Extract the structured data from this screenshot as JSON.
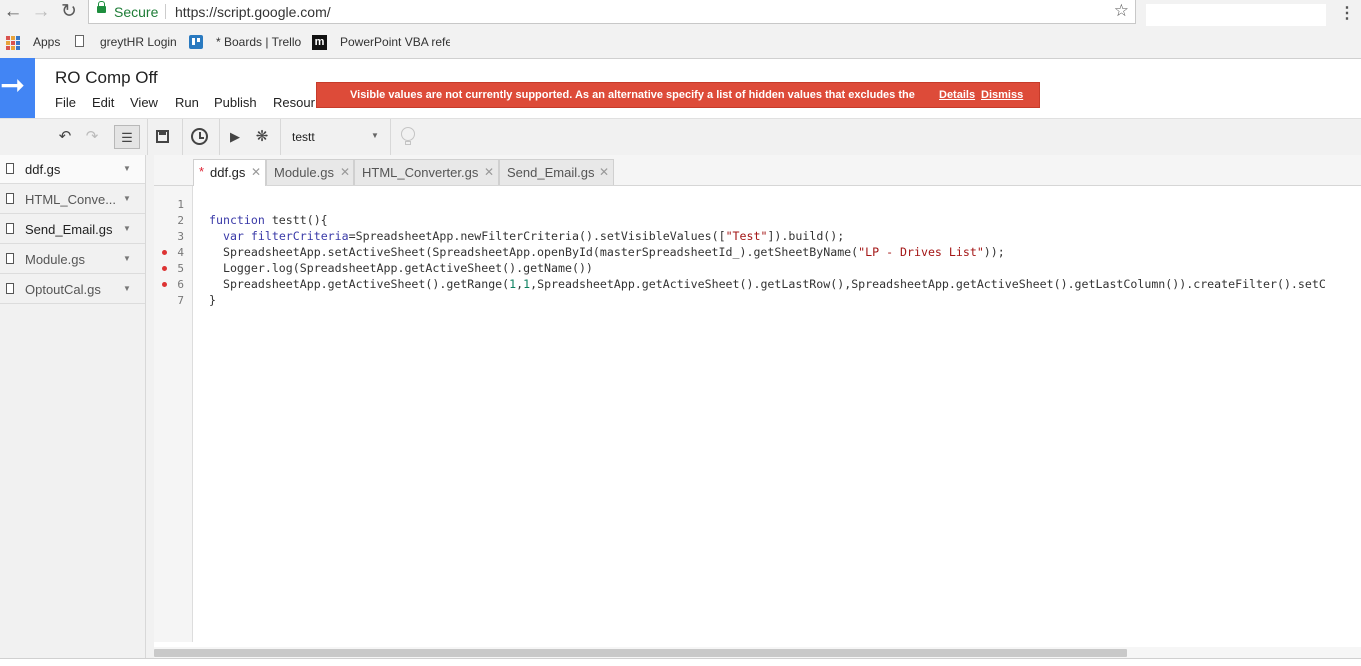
{
  "browser": {
    "secure_label": "Secure",
    "url": "https://script.google.com/",
    "bookmarks": [
      "Apps",
      "greytHR Login",
      "* Boards | Trello",
      "PowerPoint VBA refe"
    ]
  },
  "app": {
    "project_title": "RO Comp Off",
    "menu": [
      "File",
      "Edit",
      "View",
      "Run",
      "Publish",
      "Resour"
    ]
  },
  "banner": {
    "message": "Visible values are not currently supported. As an alternative specify a list of hidden values that excludes the",
    "details_label": "Details",
    "dismiss_label": "Dismiss",
    "color": "#dd4b39"
  },
  "toolbar": {
    "function_select": "testt"
  },
  "files": [
    {
      "name": "ddf.gs",
      "active": true
    },
    {
      "name": "HTML_Conve...",
      "active": false
    },
    {
      "name": "Send_Email.gs",
      "active": false
    },
    {
      "name": "Module.gs",
      "active": false
    },
    {
      "name": "OptoutCal.gs",
      "active": false
    }
  ],
  "tabs": [
    {
      "label": "ddf.gs",
      "modified_mark": "*",
      "active": true
    },
    {
      "label": "Module.gs",
      "active": false
    },
    {
      "label": "HTML_Converter.gs",
      "active": false
    },
    {
      "label": "Send_Email.gs",
      "active": false
    }
  ],
  "code": {
    "line_numbers": [
      "1",
      "2",
      "3",
      "4",
      "5",
      "6",
      "7"
    ],
    "breakpoint_lines": [
      4,
      5,
      6
    ],
    "lines": [
      "",
      "function testt(){",
      "  var filterCriteria=SpreadsheetApp.newFilterCriteria().setVisibleValues([\"Test\"]).build();",
      "  SpreadsheetApp.setActiveSheet(SpreadsheetApp.openById(masterSpreadsheetId_).getSheetByName(\"LP - Drives List\"));",
      "  Logger.log(SpreadsheetApp.getActiveSheet().getName())",
      "  SpreadsheetApp.getActiveSheet().getRange(1,1,SpreadsheetApp.getActiveSheet().getLastRow(),SpreadsheetApp.getActiveSheet().getLastColumn()).createFilter().setC",
      "}"
    ]
  }
}
